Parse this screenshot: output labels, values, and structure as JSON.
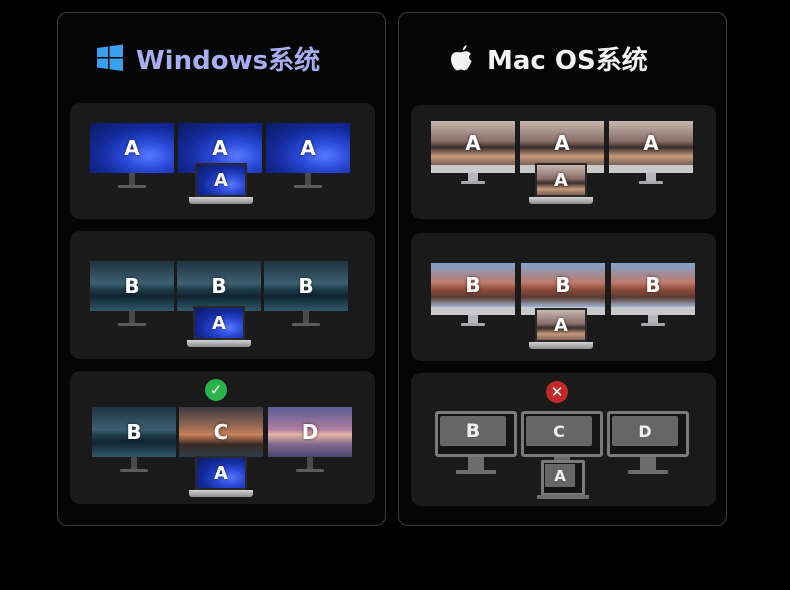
{
  "windows": {
    "title": "Windows系统",
    "rows": [
      {
        "monitors": [
          "A",
          "A",
          "A"
        ],
        "laptop": "A",
        "status": null
      },
      {
        "monitors": [
          "B",
          "B",
          "B"
        ],
        "laptop": "A",
        "status": null
      },
      {
        "monitors": [
          "B",
          "C",
          "D"
        ],
        "laptop": "A",
        "status": "check-icon"
      }
    ]
  },
  "mac": {
    "title": "Mac OS系统",
    "rows": [
      {
        "monitors": [
          "A",
          "A",
          "A"
        ],
        "laptop": "A",
        "status": null
      },
      {
        "monitors": [
          "B",
          "B",
          "B"
        ],
        "laptop": "A",
        "status": null
      },
      {
        "monitors": [
          "B",
          "C",
          "D"
        ],
        "laptop": "A",
        "status": "cross-icon"
      }
    ]
  },
  "colors": {
    "windows_title": "#a7aef0",
    "windows_logo": "#3aa0ee",
    "success": "#2bb24c",
    "error": "#c22a2a"
  }
}
